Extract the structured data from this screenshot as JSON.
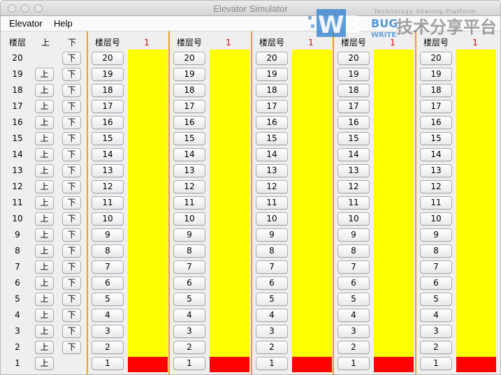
{
  "window": {
    "title": "Elevator Simulator"
  },
  "menu": {
    "items": [
      "Elevator",
      "Help"
    ]
  },
  "header": {
    "floor_col": "楼层",
    "up_col": "上",
    "down_col": "下"
  },
  "floor_labels": [
    "20",
    "19",
    "18",
    "17",
    "16",
    "15",
    "14",
    "13",
    "12",
    "11",
    "10",
    "9",
    "8",
    "7",
    "6",
    "5",
    "4",
    "3",
    "2",
    "1"
  ],
  "call_buttons": {
    "up_label": "上",
    "down_label": "下"
  },
  "elevators": [
    {
      "header_label": "楼层号",
      "current_floor": "1"
    },
    {
      "header_label": "楼层号",
      "current_floor": "1"
    },
    {
      "header_label": "楼层号",
      "current_floor": "1"
    },
    {
      "header_label": "楼层号",
      "current_floor": "1"
    },
    {
      "header_label": "楼层号",
      "current_floor": "1"
    }
  ],
  "watermark": {
    "logo_text": "WB",
    "bug": "BUG",
    "write": "WRITE",
    "tagline": "Technology Sharing Platform",
    "cn": "技术分享平台"
  },
  "colors": {
    "shaft": "#ffff00",
    "car": "#ff0000",
    "separator": "#f0a500",
    "current_floor_text": "#d40000"
  }
}
